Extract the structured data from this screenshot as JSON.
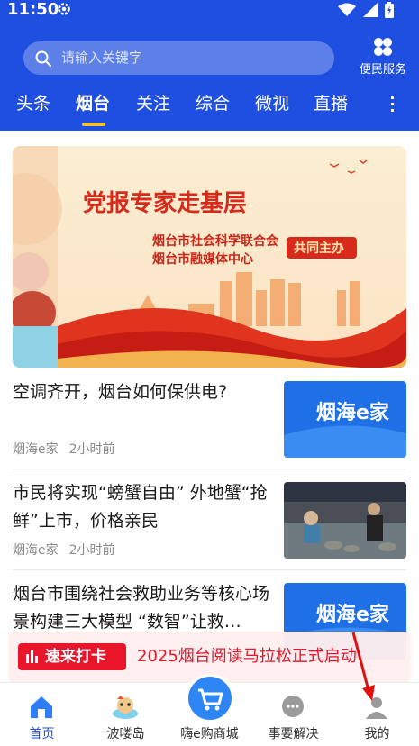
{
  "status_bar": {
    "time": "11:50"
  },
  "search": {
    "placeholder": "请输入关键字"
  },
  "service": {
    "label": "便民服务"
  },
  "tabs": [
    {
      "label": "头条"
    },
    {
      "label": "烟台"
    },
    {
      "label": "关注"
    },
    {
      "label": "综合"
    },
    {
      "label": "微视"
    },
    {
      "label": "直播"
    }
  ],
  "active_tab": "烟台",
  "banner": {
    "headline": "党报专家走基层",
    "org_line_1": "烟台市社会科学联合会",
    "org_line_2": "烟台市融媒体中心",
    "co_host": "共同主办"
  },
  "news": [
    {
      "title": "空调齐开，烟台如何保供电?",
      "source": "烟海e家",
      "time": "2小时前",
      "thumb": "烟海e家"
    },
    {
      "title": "市民将实现“螃蟹自由” 外地蟹“抢鲜”上市，价格亲民",
      "source": "烟海e家",
      "time": "2小时前",
      "thumb": ""
    },
    {
      "title": "烟台市围绕社会救助业务等核心场景构建三大模型 “数智”让救…",
      "source": "",
      "time": "",
      "thumb": "烟海e家"
    }
  ],
  "notification": {
    "badge": "速来打卡",
    "text": "2025烟台阅读马拉松正式启动"
  },
  "bottom_nav": [
    {
      "label": "首页",
      "icon": "home-icon"
    },
    {
      "label": "波喽岛",
      "icon": "mascot-icon"
    },
    {
      "label": "嗨e购商城",
      "icon": "cart-icon"
    },
    {
      "label": "事要解决",
      "icon": "chat-icon"
    },
    {
      "label": "我的",
      "icon": "user-icon"
    }
  ],
  "colors": {
    "brand": "#1f4fe0",
    "accent": "#f2c230",
    "alert": "#e8152b"
  }
}
